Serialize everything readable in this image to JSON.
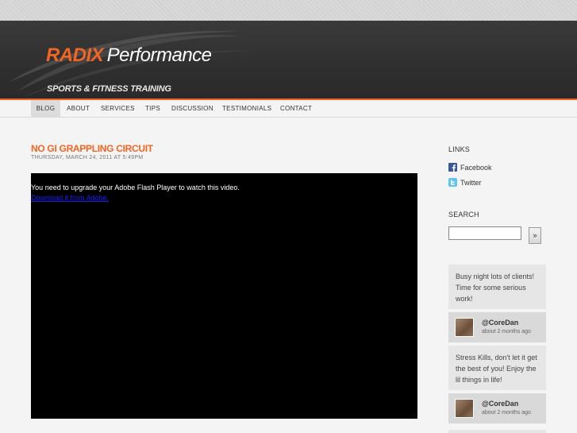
{
  "brand": {
    "name_bold": "RADIX",
    "name_light": "Performance",
    "tagline": "SPORTS & FITNESS TRAINING",
    "accent_color": "#f26522"
  },
  "nav": {
    "items": [
      {
        "label": "BLOG",
        "active": true
      },
      {
        "label": "ABOUT"
      },
      {
        "label": "SERVICES"
      },
      {
        "label": "TIPS"
      },
      {
        "label": "DISCUSSION"
      },
      {
        "label": "TESTIMONIALS"
      },
      {
        "label": "CONTACT"
      }
    ]
  },
  "post": {
    "title": "NO GI GRAPPLING CIRCUIT",
    "date": "THURSDAY, MARCH 24, 2011 AT 5:49PM",
    "video": {
      "message": "You need to upgrade your Adobe Flash Player to watch this video.",
      "link_text": "Download it from Adobe."
    }
  },
  "sidebar": {
    "links_heading": "LINKS",
    "links": [
      {
        "label": "Facebook",
        "icon": "facebook-icon"
      },
      {
        "label": "Twitter",
        "icon": "twitter-icon"
      }
    ],
    "search_heading": "SEARCH",
    "search_value": "",
    "search_button": "»",
    "tweets": [
      {
        "text": "Busy night lots of clients! Time for some serious work!",
        "user": "@CoreDan",
        "time": "about 2 months ago"
      },
      {
        "text": "Stress Kills, don't let it get the best of you! Enjoy the lil things in life!",
        "user": "@CoreDan",
        "time": "about 2 months ago"
      }
    ]
  }
}
